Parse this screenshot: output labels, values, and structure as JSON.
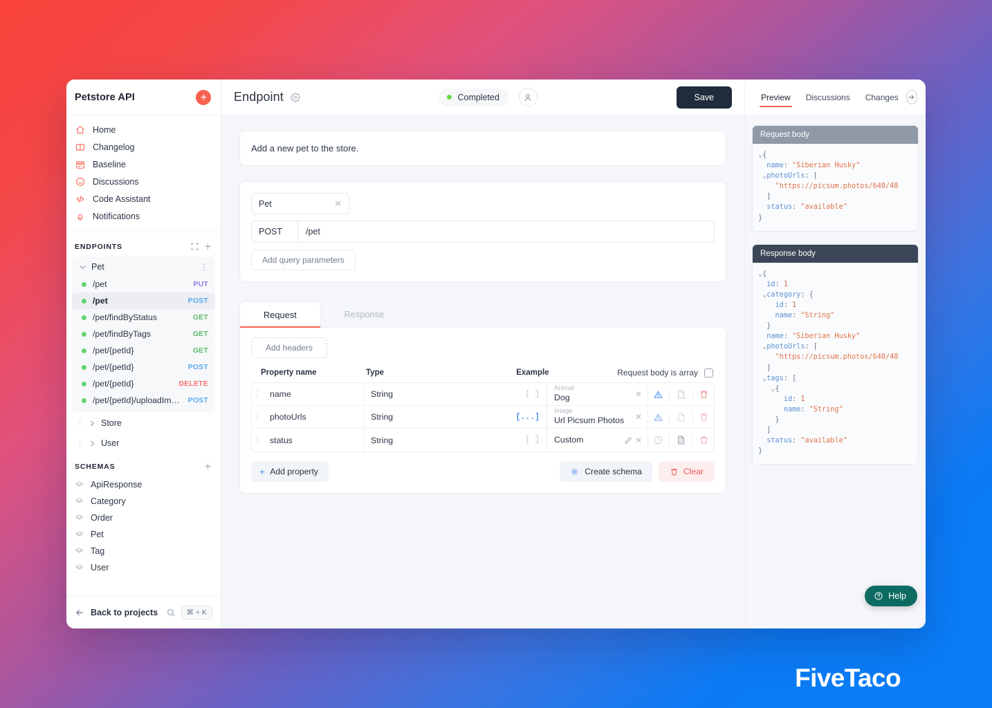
{
  "sidebar": {
    "title": "Petstore API",
    "add_button_label": "+",
    "nav": [
      {
        "label": "Home",
        "icon": "home-icon"
      },
      {
        "label": "Changelog",
        "icon": "book-icon"
      },
      {
        "label": "Baseline",
        "icon": "calendar-icon"
      },
      {
        "label": "Discussions",
        "icon": "chat-icon"
      },
      {
        "label": "Code Assistant",
        "icon": "code-icon"
      },
      {
        "label": "Notifications",
        "icon": "bell-icon"
      }
    ],
    "endpoints_section": {
      "title": "ENDPOINTS",
      "group": "Pet",
      "items": [
        {
          "path": "/pet",
          "method": "PUT",
          "active": false
        },
        {
          "path": "/pet",
          "method": "POST",
          "active": true
        },
        {
          "path": "/pet/findByStatus",
          "method": "GET",
          "active": false
        },
        {
          "path": "/pet/findByTags",
          "method": "GET",
          "active": false
        },
        {
          "path": "/pet/{petId}",
          "method": "GET",
          "active": false
        },
        {
          "path": "/pet/{petId}",
          "method": "POST",
          "active": false
        },
        {
          "path": "/pet/{petId}",
          "method": "DELETE",
          "active": false
        },
        {
          "path": "/pet/{petId}/uploadImage",
          "method": "POST",
          "active": false
        }
      ],
      "collapsed_groups": [
        "Store",
        "User"
      ]
    },
    "schemas_section": {
      "title": "SCHEMAS",
      "items": [
        "ApiResponse",
        "Category",
        "Order",
        "Pet",
        "Tag",
        "User"
      ]
    },
    "footer": {
      "back_label": "Back to projects",
      "shortcut": "⌘ + K"
    }
  },
  "header": {
    "title": "Endpoint",
    "status": "Completed",
    "save_label": "Save"
  },
  "endpoint": {
    "description": "Add a new pet to the store.",
    "tag": "Pet",
    "method": "POST",
    "path": "/pet",
    "add_query_params_label": "Add query parameters"
  },
  "tabs": [
    {
      "label": "Request",
      "active": true
    },
    {
      "label": "Response",
      "active": false
    }
  ],
  "request": {
    "add_headers_label": "Add headers",
    "columns": {
      "property": "Property name",
      "type": "Type",
      "example": "Example",
      "is_array": "Request body is array"
    },
    "rows": [
      {
        "property": "name",
        "type": "String",
        "array_toggle": "[ ]",
        "array_on": false,
        "example_label": "Animal",
        "example_value": "Dog",
        "has_pencil": false,
        "status_icon": "warning-icon",
        "doc_icon": "document-outline-icon"
      },
      {
        "property": "photoUrls",
        "type": "String",
        "array_toggle": "[...]",
        "array_on": true,
        "example_label": "Image",
        "example_value": "Url Picsum Photos",
        "has_pencil": false,
        "status_icon": "warning-icon",
        "doc_icon": "document-outline-icon"
      },
      {
        "property": "status",
        "type": "String",
        "array_toggle": "[ ]",
        "array_on": false,
        "example_label": "",
        "example_value": "Custom",
        "has_pencil": true,
        "status_icon": "info-icon",
        "doc_icon": "document-filled-icon"
      }
    ],
    "add_property_label": "Add property",
    "create_schema_label": "Create schema",
    "clear_label": "Clear"
  },
  "right_panel": {
    "tabs": [
      {
        "label": "Preview",
        "active": true
      },
      {
        "label": "Discussions",
        "active": false
      },
      {
        "label": "Changes",
        "active": false
      }
    ],
    "request_body": {
      "title": "Request body",
      "lines": [
        {
          "caret": "v",
          "indent": 0,
          "pun": "{"
        },
        {
          "indent": 1,
          "key": "name",
          "sep": ": ",
          "str": "\"Siberian Husky\""
        },
        {
          "caret": "v",
          "indent": 1,
          "key": "photoUrls",
          "sep": ": ",
          "pun": "["
        },
        {
          "indent": 2,
          "str": "\"https://picsum.photos/640/48"
        },
        {
          "indent": 1,
          "pun": "]"
        },
        {
          "indent": 1,
          "key": "status",
          "sep": ": ",
          "str": "\"available\""
        },
        {
          "indent": 0,
          "pun": "}"
        }
      ]
    },
    "response_body": {
      "title": "Response body",
      "lines": [
        {
          "caret": "v",
          "indent": 0,
          "pun": "{"
        },
        {
          "indent": 1,
          "key": "id",
          "sep": ": ",
          "num": "1"
        },
        {
          "caret": "v",
          "indent": 1,
          "key": "category",
          "sep": ": ",
          "pun": "{"
        },
        {
          "indent": 2,
          "key": "id",
          "sep": ": ",
          "num": "1"
        },
        {
          "indent": 2,
          "key": "name",
          "sep": ": ",
          "str": "\"String\""
        },
        {
          "indent": 1,
          "pun": "}"
        },
        {
          "indent": 1,
          "key": "name",
          "sep": ": ",
          "str": "\"Siberian Husky\""
        },
        {
          "caret": "v",
          "indent": 1,
          "key": "photoUrls",
          "sep": ": ",
          "pun": "["
        },
        {
          "indent": 2,
          "str": "\"https://picsum.photos/640/48"
        },
        {
          "indent": 1,
          "pun": "]"
        },
        {
          "caret": "v",
          "indent": 1,
          "key": "tags",
          "sep": ": ",
          "pun": "["
        },
        {
          "caret": "v",
          "indent": 2,
          "pun": "{"
        },
        {
          "indent": 3,
          "key": "id",
          "sep": ": ",
          "num": "1"
        },
        {
          "indent": 3,
          "key": "name",
          "sep": ": ",
          "str": "\"String\""
        },
        {
          "indent": 2,
          "pun": "}"
        },
        {
          "indent": 1,
          "pun": "]"
        },
        {
          "indent": 1,
          "key": "status",
          "sep": ": ",
          "str": "\"available\""
        },
        {
          "indent": 0,
          "pun": "}"
        }
      ]
    },
    "help_label": "Help"
  },
  "watermark": "FiveTaco",
  "colors": {
    "accent_red": "#f8604f",
    "save_dark": "#202b3c",
    "status_green": "#6fd644",
    "method_put": "#8f7ae5",
    "method_post": "#5aa9f0",
    "method_get": "#5cbb6a",
    "method_delete": "#f87171",
    "help_teal": "#0e6b62"
  }
}
